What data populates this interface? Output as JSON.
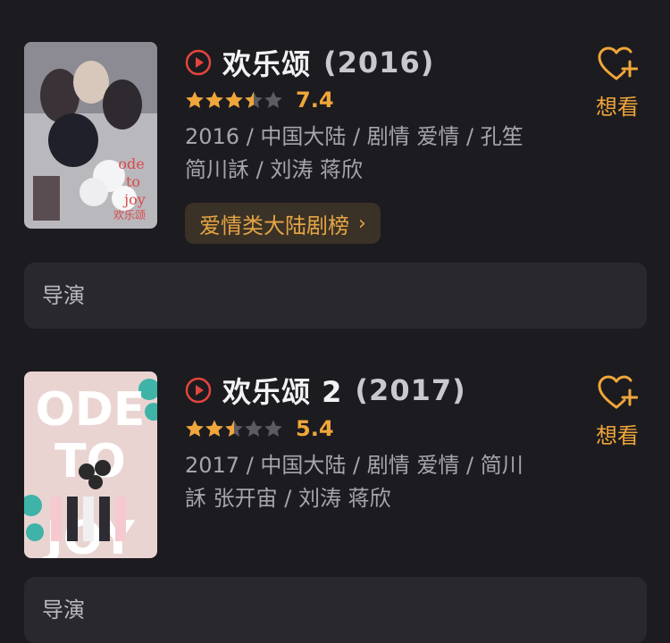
{
  "colors": {
    "background": "#1c1b20",
    "accent": "#f0a63a",
    "play": "#e2453c",
    "card": "#29282e"
  },
  "movies": [
    {
      "title": "欢乐颂",
      "year": "(2016)",
      "rating": "7.4",
      "stars_value": 3.5,
      "meta": "2016 / 中国大陆 / 剧情 爱情 / 孔笙 简川訸 / 刘涛 蒋欣",
      "ranking": "爱情类大陆剧榜",
      "want_label": "想看",
      "director_label": "导演",
      "poster_icon": "poster-image"
    },
    {
      "title": "欢乐颂 2",
      "year": "(2017)",
      "rating": "5.4",
      "stars_value": 2.5,
      "meta": "2017 / 中国大陆 / 剧情 爱情 / 简川訸 张开宙 / 刘涛 蒋欣",
      "want_label": "想看",
      "director_label": "导演",
      "poster_text": "ODE TO JOY",
      "poster_icon": "poster-image"
    }
  ]
}
